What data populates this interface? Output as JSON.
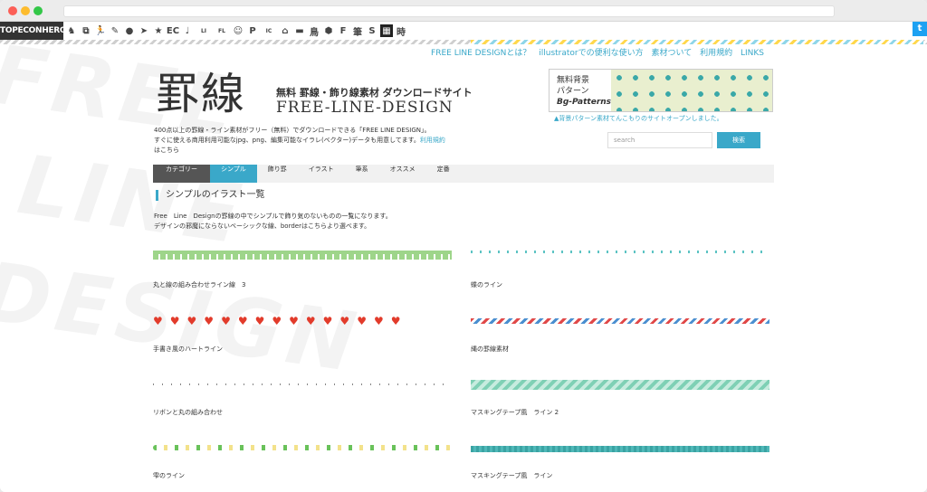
{
  "browser": {
    "url": ""
  },
  "topbar": {
    "brand": "TOPECONHEROES",
    "icons": [
      {
        "name": "horse-icon",
        "glyph": "♞"
      },
      {
        "name": "copy-icon",
        "glyph": "⧉"
      },
      {
        "name": "runner-icon",
        "glyph": "🏃"
      },
      {
        "name": "pen-icon",
        "glyph": "✎"
      },
      {
        "name": "speech-bubble-icon",
        "glyph": "●"
      },
      {
        "name": "arrow-icon",
        "glyph": "➤"
      },
      {
        "name": "star-icon",
        "glyph": "★"
      },
      {
        "name": "ec-icon",
        "glyph": "EC"
      },
      {
        "name": "music-note-icon",
        "glyph": "♩"
      },
      {
        "name": "line-icon",
        "glyph": "LINE"
      },
      {
        "name": "flat-icon",
        "glyph": "FLAT"
      },
      {
        "name": "face-icon",
        "glyph": "☺"
      },
      {
        "name": "p-icon",
        "glyph": "P"
      },
      {
        "name": "icon-on-icon",
        "glyph": "ICON"
      },
      {
        "name": "house-icon",
        "glyph": "⌂"
      },
      {
        "name": "pattern-icon",
        "glyph": "▬"
      },
      {
        "name": "bird-icon",
        "glyph": "鳥"
      },
      {
        "name": "hexagon-icon",
        "glyph": "⬢"
      },
      {
        "name": "f-icon",
        "glyph": "F"
      },
      {
        "name": "brush-icon",
        "glyph": "筆"
      },
      {
        "name": "s-icon",
        "glyph": "S"
      },
      {
        "name": "grid-icon",
        "glyph": "▦"
      },
      {
        "name": "time-icon",
        "glyph": "時"
      }
    ],
    "twitter_glyph": "t"
  },
  "header": {
    "links": [
      "FREE LINE DESIGNとは？",
      "illustratorでの便利な使い方",
      "素材ついて",
      "利用規約",
      "LINKS"
    ],
    "logo_kanji": "罫線",
    "logo_sub": "無料 罫線・飾り線素材 ダウンロードサイト",
    "logo_en": "FREE-LINE-DESIGN",
    "intro_line1": "400点以上の罫線・ライン素材がフリー（無料）でダウンロードできる「FREE LINE DESIGN」。",
    "intro_line2": "すぐに使える商用利用可能なjpg、png、編集可能なイラレ(ベクター)データも用意してます。",
    "intro_link": "利用規約",
    "intro_line3": "はこちら"
  },
  "banner": {
    "line1": "無料背景",
    "line2": "パターン",
    "line3": "Bg-Patterns",
    "caption": "▲背景パターン素材てんこもりのサイトオープンしました。"
  },
  "search": {
    "placeholder": "search",
    "button": "検索"
  },
  "nav": {
    "category": "カテゴリー",
    "items": [
      "シンプル",
      "飾り罫",
      "イラスト",
      "筆系",
      "オススメ",
      "定番"
    ]
  },
  "section": {
    "title": "シンプルのイラスト一覧",
    "desc1": "Free　Line　Designの罫線の中でシンプルで飾り気のないものの一覧になります。",
    "desc2": "デザインの邪魔にならないベーシックな線、borderはこちらより選べます。"
  },
  "items": [
    {
      "label": "丸と線の組み合わせライン線　3"
    },
    {
      "label": "蝶のライン"
    },
    {
      "label": "手書き風のハートライン"
    },
    {
      "label": "縄の罫線素材"
    },
    {
      "label": "リボンと丸の組み合わせ"
    },
    {
      "label": "マスキングテープ風　ライン 2"
    },
    {
      "label": "雫のライン"
    },
    {
      "label": "マスキングテープ風　ライン"
    }
  ],
  "background_words": [
    "FREE",
    "LINE",
    "DESIGN"
  ],
  "colors": {
    "accent": "#3aa8c9",
    "heart": "#e23b2b",
    "nav_dark": "#555555"
  }
}
